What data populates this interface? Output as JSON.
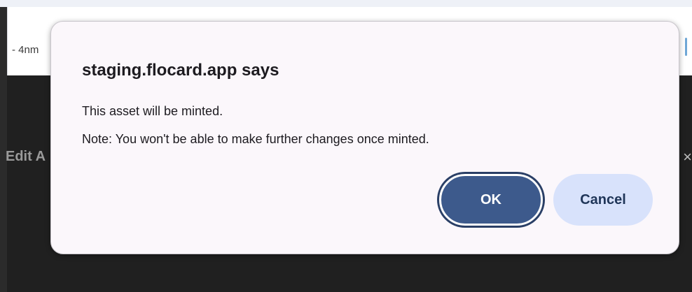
{
  "browser": {
    "url_fragment": "- 4nm"
  },
  "background_page": {
    "header_label": "Edit A",
    "close_glyph": "×"
  },
  "dialog": {
    "title": "staging.flocard.app says",
    "message_line_1": "This asset will be minted.",
    "message_line_2": "Note: You won't be able to make further changes once minted.",
    "ok_label": "OK",
    "cancel_label": "Cancel"
  },
  "colors": {
    "ok_button": "#3d5a8c",
    "cancel_button": "#d8e2fb",
    "dialog_background": "#fbf7fb"
  }
}
